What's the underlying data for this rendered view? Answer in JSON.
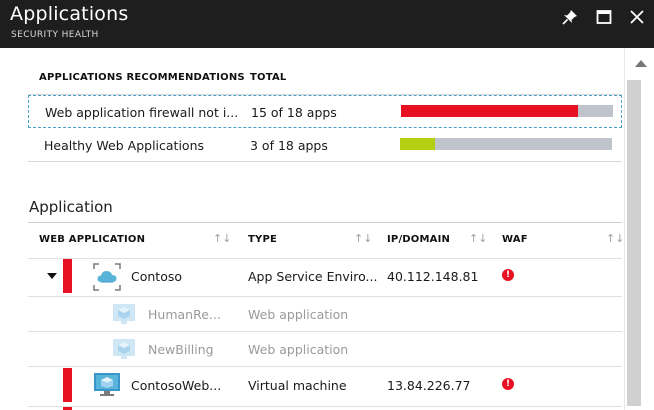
{
  "header": {
    "title": "Applications",
    "subtitle": "SECURITY HEALTH",
    "bg_color": "#1e1e1e"
  },
  "recommendations": {
    "columns": [
      "APPLICATIONS RECOMMENDATIONS",
      "TOTAL"
    ],
    "rows": [
      {
        "name": "Web application firewall not i...",
        "total": "15 of 18 apps",
        "fraction": 0.833,
        "color": "#e81123"
      },
      {
        "name": "Healthy Web Applications",
        "total": "3 of 18 apps",
        "fraction": 0.167,
        "color": "#b4cf12"
      }
    ],
    "bar_track_color": "#bfc4cc"
  },
  "application": {
    "section_title": "Application",
    "columns": [
      "WEB APPLICATION",
      "TYPE",
      "IP/DOMAIN",
      "WAF"
    ],
    "sort_glyph": "↑↓",
    "rows": [
      {
        "name": "Contoso",
        "type": "App Service Enviro...",
        "ip": "40.112.148.81",
        "waf_alert": "!",
        "expanded": true,
        "icon": "app-service-environment-icon"
      },
      {
        "name": "HumanRe...",
        "type": "Web application",
        "ip": "",
        "child": true,
        "icon": "web-app-icon"
      },
      {
        "name": "NewBilling",
        "type": "Web application",
        "ip": "",
        "child": true,
        "icon": "web-app-icon"
      },
      {
        "name": "ContosoWeb...",
        "type": "Virtual machine",
        "ip": "13.84.226.77",
        "waf_alert": "!",
        "icon": "virtual-machine-icon"
      }
    ],
    "alert_color": "#e81123"
  }
}
